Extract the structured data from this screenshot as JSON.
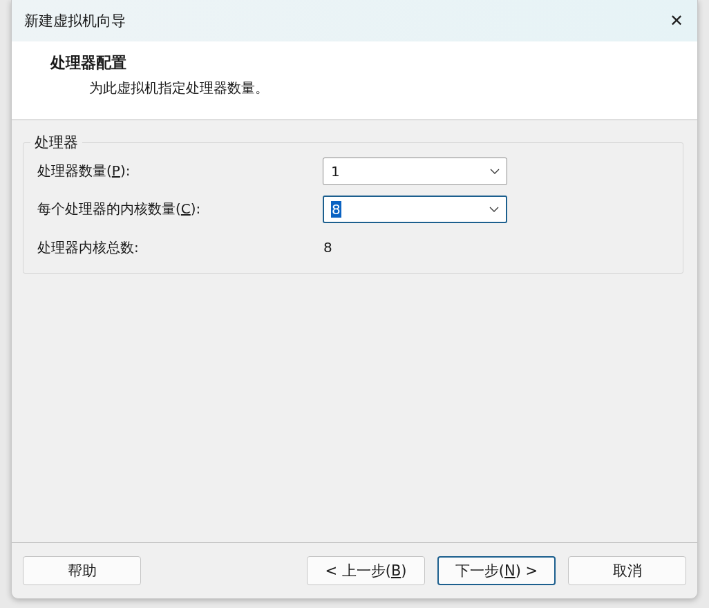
{
  "window": {
    "title": "新建虚拟机向导",
    "close": "✕"
  },
  "header": {
    "title": "处理器配置",
    "subtitle": "为此虚拟机指定处理器数量。"
  },
  "group": {
    "title": "处理器",
    "rows": [
      {
        "kind": "dropdown",
        "label": {
          "before": "处理器数量(",
          "key": "P",
          "after": "):"
        },
        "value": "1",
        "focused": false
      },
      {
        "kind": "dropdown",
        "label": {
          "before": "每个处理器的内核数量(",
          "key": "C",
          "after": "):"
        },
        "value": "8",
        "focused": true
      },
      {
        "kind": "readout",
        "label": {
          "before": "处理器内核总数:"
        },
        "value": "8"
      }
    ]
  },
  "footer": {
    "left_buttons": [
      {
        "label": {
          "before": "帮助"
        },
        "default": false
      }
    ],
    "right_buttons": [
      {
        "label": {
          "before": "< 上一步(",
          "key": "B",
          "after": ")"
        },
        "default": false
      },
      {
        "label": {
          "before": "下一步(",
          "key": "N",
          "after": ") >"
        },
        "default": true
      },
      {
        "label": {
          "before": "取消"
        },
        "default": false
      }
    ]
  }
}
